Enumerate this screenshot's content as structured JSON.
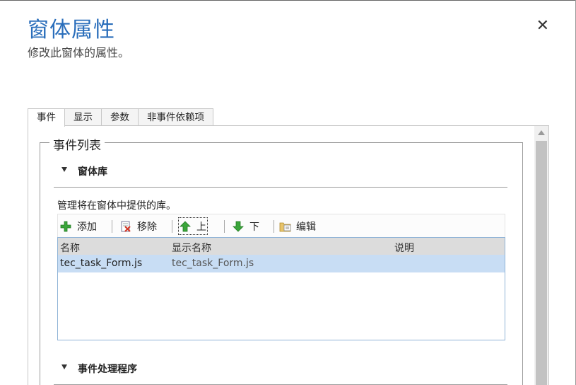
{
  "dialog": {
    "title": "窗体属性",
    "subtitle": "修改此窗体的属性。",
    "close_icon": "close-icon"
  },
  "tabs": [
    {
      "label": "事件",
      "active": true
    },
    {
      "label": "显示",
      "active": false
    },
    {
      "label": "参数",
      "active": false
    },
    {
      "label": "非事件依赖项",
      "active": false
    }
  ],
  "event_list": {
    "legend": "事件列表",
    "form_library": {
      "heading": "窗体库",
      "description": "管理将在窗体中提供的库。",
      "toolbar": {
        "add": "添加",
        "remove": "移除",
        "up": "上",
        "down": "下",
        "edit": "编辑"
      },
      "columns": [
        "名称",
        "显示名称",
        "说明"
      ],
      "rows": [
        {
          "name": "tec_task_Form.js",
          "display_name": "tec_task_Form.js",
          "description": ""
        }
      ]
    },
    "event_handlers": {
      "heading": "事件处理程序"
    }
  },
  "colors": {
    "title": "#2a6ebb",
    "selected_row": "#c8ddf4",
    "grid_header": "#dcdcdc",
    "grid_border": "#8fb3d6"
  }
}
